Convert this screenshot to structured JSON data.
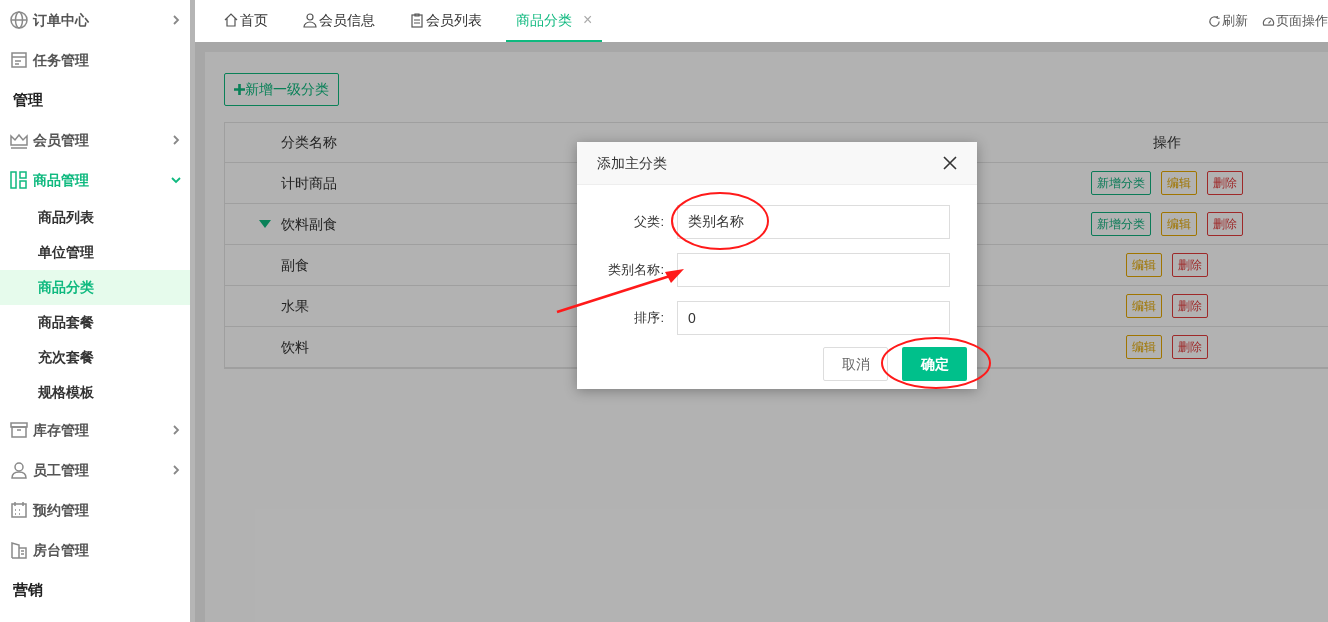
{
  "sidebar": {
    "items": [
      {
        "kind": "item",
        "label": "订单中心",
        "expandable": true,
        "expanded": false,
        "selected": false
      },
      {
        "kind": "item",
        "label": "任务管理",
        "expandable": false,
        "selected": false
      },
      {
        "kind": "section",
        "label": "管理"
      },
      {
        "kind": "item",
        "label": "会员管理",
        "expandable": true,
        "expanded": false,
        "selected": false
      },
      {
        "kind": "item",
        "label": "商品管理",
        "expandable": true,
        "expanded": true,
        "selected": true,
        "children": [
          {
            "label": "商品列表",
            "selected": false
          },
          {
            "label": "单位管理",
            "selected": false
          },
          {
            "label": "商品分类",
            "selected": true
          },
          {
            "label": "商品套餐",
            "selected": false
          },
          {
            "label": "充次套餐",
            "selected": false
          },
          {
            "label": "规格模板",
            "selected": false
          }
        ]
      },
      {
        "kind": "item",
        "label": "库存管理",
        "expandable": true,
        "expanded": false,
        "selected": false
      },
      {
        "kind": "item",
        "label": "员工管理",
        "expandable": true,
        "expanded": false,
        "selected": false
      },
      {
        "kind": "item",
        "label": "预约管理",
        "expandable": false,
        "selected": false
      },
      {
        "kind": "item",
        "label": "房台管理",
        "expandable": false,
        "selected": false
      },
      {
        "kind": "section",
        "label": "营销"
      }
    ]
  },
  "tabs": [
    {
      "label": "首页",
      "selected": false,
      "closable": false
    },
    {
      "label": "会员信息",
      "selected": false,
      "closable": false
    },
    {
      "label": "会员列表",
      "selected": false,
      "closable": false
    },
    {
      "label": "商品分类",
      "selected": true,
      "closable": true,
      "close": "×"
    }
  ],
  "toolbar": [
    {
      "label": "刷新"
    },
    {
      "label": "页面操作"
    }
  ],
  "add_button": "新增一级分类",
  "table": {
    "columns": [
      {
        "kind": "name",
        "label": "分类名称"
      },
      {
        "kind": "actions",
        "label": "操作"
      }
    ],
    "rows": [
      {
        "name": "计时商品",
        "has_children": false,
        "actions": [
          {
            "kind": "add",
            "label": "新增分类"
          },
          {
            "kind": "edit",
            "label": "编辑"
          },
          {
            "kind": "delete",
            "label": "删除"
          }
        ]
      },
      {
        "name": "饮料副食",
        "has_children": true,
        "expanded": true,
        "actions": [
          {
            "kind": "add",
            "label": "新增分类"
          },
          {
            "kind": "edit",
            "label": "编辑"
          },
          {
            "kind": "delete",
            "label": "删除"
          }
        ]
      },
      {
        "name": "副食",
        "has_children": false,
        "actions": [
          {
            "kind": "edit",
            "label": "编辑"
          },
          {
            "kind": "delete",
            "label": "删除"
          }
        ]
      },
      {
        "name": "水果",
        "has_children": false,
        "actions": [
          {
            "kind": "edit",
            "label": "编辑"
          },
          {
            "kind": "delete",
            "label": "删除"
          }
        ]
      },
      {
        "name": "饮料",
        "has_children": false,
        "actions": [
          {
            "kind": "edit",
            "label": "编辑"
          },
          {
            "kind": "delete",
            "label": "删除"
          }
        ]
      }
    ]
  },
  "dialog": {
    "title": "添加主分类",
    "fields": [
      {
        "label": "父类:",
        "value": "类别名称"
      },
      {
        "label": "类别名称:"
      },
      {
        "label": "排序:",
        "value": "0"
      }
    ],
    "buttons": [
      {
        "kind": "secondary",
        "label": "取消"
      },
      {
        "kind": "primary",
        "label": "确定"
      }
    ]
  }
}
